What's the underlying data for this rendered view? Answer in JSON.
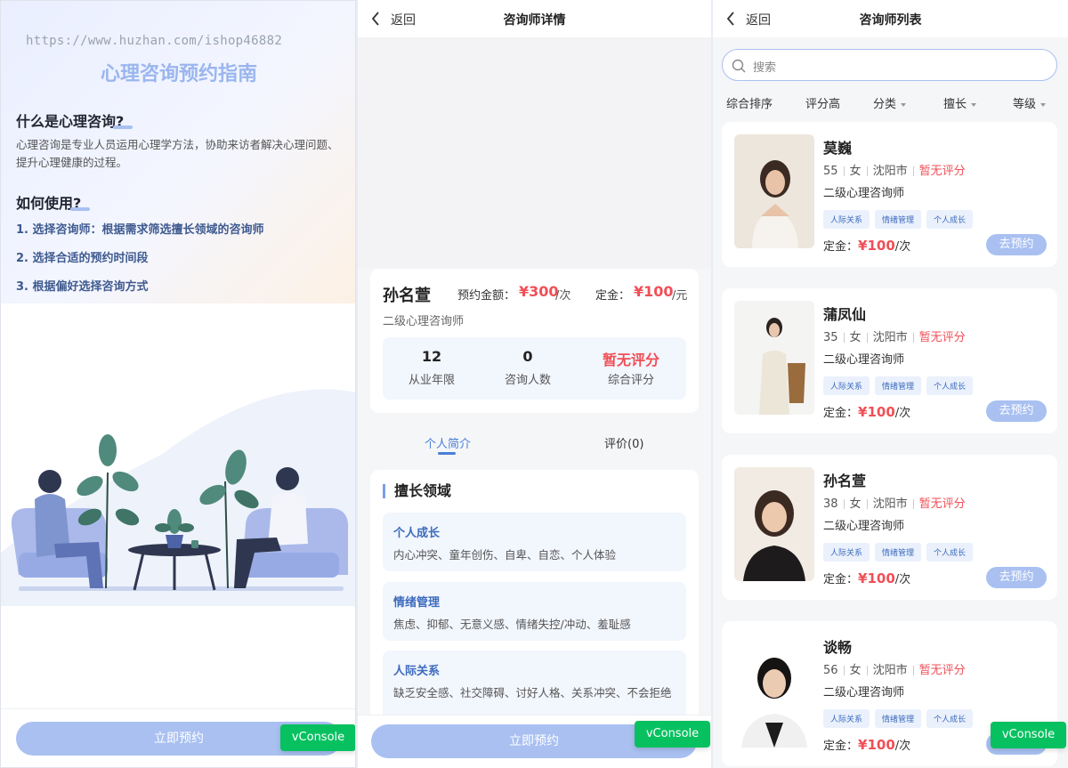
{
  "guide": {
    "watermark": "https://www.huzhan.com/ishop46882",
    "title": "心理咨询预约指南",
    "what_heading": "什么是心理咨询?",
    "what_text": "心理咨询是专业人员运用心理学方法，协助来访者解决心理问题、提升心理健康的过程。",
    "how_heading": "如何使用?",
    "steps": [
      "1. 选择咨询师：根据需求筛选擅长领域的咨询师",
      "2. 选择合适的预约时间段",
      "3. 根据偏好选择咨询方式"
    ],
    "book_button": "立即预约",
    "vconsole": "vConsole"
  },
  "detail": {
    "back": "返回",
    "title": "咨询师详情",
    "name": "孙名萱",
    "fee_label": "预约金额：",
    "fee_value": "¥300",
    "fee_unit": "/次",
    "deposit_label": "定金：",
    "deposit_value": "¥100",
    "deposit_unit": "/元",
    "level": "二级心理咨询师",
    "stats": [
      {
        "value": "12",
        "label": "从业年限"
      },
      {
        "value": "0",
        "label": "咨询人数"
      },
      {
        "value": "暂无评分",
        "label": "综合评分"
      }
    ],
    "tabs": [
      "个人简介",
      "评价(0)"
    ],
    "specialty_title": "擅长领域",
    "specialties": [
      {
        "title": "个人成长",
        "desc": "内心冲突、童年创伤、自卑、自恋、个人体验"
      },
      {
        "title": "情绪管理",
        "desc": "焦虑、抑郁、无意义感、情绪失控/冲动、羞耻感"
      },
      {
        "title": "人际关系",
        "desc": "缺乏安全感、社交障碍、讨好人格、关系冲突、不会拒绝"
      }
    ],
    "book_button": "立即预约",
    "vconsole": "vConsole"
  },
  "list": {
    "back": "返回",
    "title": "咨询师列表",
    "search_placeholder": "搜索",
    "filters": [
      "综合排序",
      "评分高",
      "分类",
      "擅长",
      "等级"
    ],
    "vconsole": "vConsole",
    "counselors": [
      {
        "name": "莫巍",
        "age": "55",
        "gender": "女",
        "city": "沈阳市",
        "rating": "暂无评分",
        "level": "二级心理咨询师",
        "tags": [
          "人际关系",
          "情绪管理",
          "个人成长"
        ],
        "deposit_label": "定金：",
        "deposit": "¥100",
        "unit": "/次",
        "button": "去预约"
      },
      {
        "name": "蒲凤仙",
        "age": "35",
        "gender": "女",
        "city": "沈阳市",
        "rating": "暂无评分",
        "level": "二级心理咨询师",
        "tags": [
          "人际关系",
          "情绪管理",
          "个人成长"
        ],
        "deposit_label": "定金：",
        "deposit": "¥100",
        "unit": "/次",
        "button": "去预约"
      },
      {
        "name": "孙名萱",
        "age": "38",
        "gender": "女",
        "city": "沈阳市",
        "rating": "暂无评分",
        "level": "二级心理咨询师",
        "tags": [
          "人际关系",
          "情绪管理",
          "个人成长"
        ],
        "deposit_label": "定金：",
        "deposit": "¥100",
        "unit": "/次",
        "button": "去预约"
      },
      {
        "name": "谈畅",
        "age": "56",
        "gender": "女",
        "city": "沈阳市",
        "rating": "暂无评分",
        "level": "二级心理咨询师",
        "tags": [
          "人际关系",
          "情绪管理",
          "个人成长"
        ],
        "deposit_label": "定金：",
        "deposit": "¥100",
        "unit": "/次",
        "button": "去预约"
      }
    ]
  },
  "colors": {
    "accent": "#a9c0f1",
    "price": "#f04f57",
    "link": "#4a7fd6",
    "vconsole": "#07c160"
  }
}
